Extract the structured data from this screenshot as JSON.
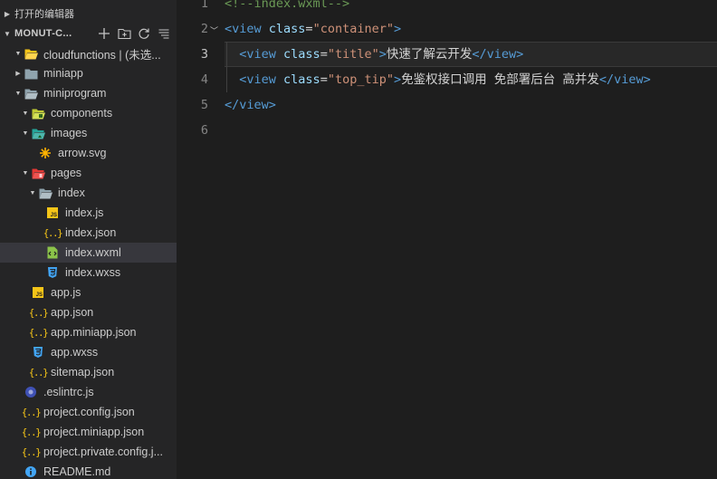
{
  "sidebar": {
    "open_editors_label": "打开的编辑器",
    "root_label": "MONUT-C...",
    "actions": [
      {
        "name": "new-file-icon"
      },
      {
        "name": "new-folder-icon"
      },
      {
        "name": "refresh-icon"
      },
      {
        "name": "collapse-all-icon"
      }
    ],
    "items": [
      {
        "depth": 0,
        "twisty": "open",
        "icon": "folder-cloud",
        "label": "cloudfunctions | (未选..."
      },
      {
        "depth": 0,
        "twisty": "closed",
        "icon": "folder",
        "label": "miniapp"
      },
      {
        "depth": 0,
        "twisty": "open",
        "icon": "folder-open",
        "label": "miniprogram"
      },
      {
        "depth": 1,
        "twisty": "open",
        "icon": "folder-components",
        "label": "components"
      },
      {
        "depth": 1,
        "twisty": "open",
        "icon": "folder-images",
        "label": "images"
      },
      {
        "depth": 2,
        "twisty": "none",
        "icon": "svg",
        "label": "arrow.svg"
      },
      {
        "depth": 1,
        "twisty": "open",
        "icon": "folder-pages",
        "label": "pages"
      },
      {
        "depth": 2,
        "twisty": "open",
        "icon": "folder-open",
        "label": "index"
      },
      {
        "depth": 3,
        "twisty": "none",
        "icon": "js",
        "label": "index.js"
      },
      {
        "depth": 3,
        "twisty": "none",
        "icon": "json",
        "label": "index.json"
      },
      {
        "depth": 3,
        "twisty": "none",
        "icon": "wxml",
        "label": "index.wxml",
        "selected": true
      },
      {
        "depth": 3,
        "twisty": "none",
        "icon": "css",
        "label": "index.wxss"
      },
      {
        "depth": 1,
        "twisty": "none",
        "icon": "js",
        "label": "app.js"
      },
      {
        "depth": 1,
        "twisty": "none",
        "icon": "json",
        "label": "app.json"
      },
      {
        "depth": 1,
        "twisty": "none",
        "icon": "json",
        "label": "app.miniapp.json"
      },
      {
        "depth": 1,
        "twisty": "none",
        "icon": "css",
        "label": "app.wxss"
      },
      {
        "depth": 1,
        "twisty": "none",
        "icon": "json",
        "label": "sitemap.json"
      },
      {
        "depth": 0,
        "twisty": "none",
        "icon": "eslint",
        "label": ".eslintrc.js"
      },
      {
        "depth": 0,
        "twisty": "none",
        "icon": "json",
        "label": "project.config.json"
      },
      {
        "depth": 0,
        "twisty": "none",
        "icon": "json",
        "label": "project.miniapp.json"
      },
      {
        "depth": 0,
        "twisty": "none",
        "icon": "json",
        "label": "project.private.config.j..."
      },
      {
        "depth": 0,
        "twisty": "none",
        "icon": "info",
        "label": "README.md"
      }
    ]
  },
  "editor": {
    "active_line": 3,
    "lines": [
      {
        "num": "1",
        "fold": false,
        "tokens": [
          {
            "t": "cm",
            "v": "<!--index.wxml-->"
          }
        ]
      },
      {
        "num": "2",
        "fold": true,
        "tokens": [
          {
            "t": "tag",
            "v": "<view"
          },
          {
            "t": "text",
            "v": " "
          },
          {
            "t": "attr",
            "v": "class"
          },
          {
            "t": "eq",
            "v": "="
          },
          {
            "t": "str",
            "v": "\"container\""
          },
          {
            "t": "tag",
            "v": ">"
          }
        ]
      },
      {
        "num": "3",
        "fold": false,
        "indent": true,
        "tokens": [
          {
            "t": "text",
            "v": "  "
          },
          {
            "t": "tag",
            "v": "<view"
          },
          {
            "t": "text",
            "v": " "
          },
          {
            "t": "attr",
            "v": "class"
          },
          {
            "t": "eq",
            "v": "="
          },
          {
            "t": "str",
            "v": "\"title\""
          },
          {
            "t": "tag",
            "v": ">"
          },
          {
            "t": "text",
            "v": "快速了解云开发"
          },
          {
            "t": "tag",
            "v": "</view>"
          }
        ]
      },
      {
        "num": "4",
        "fold": false,
        "indent": true,
        "tokens": [
          {
            "t": "text",
            "v": "  "
          },
          {
            "t": "tag",
            "v": "<view"
          },
          {
            "t": "text",
            "v": " "
          },
          {
            "t": "attr",
            "v": "class"
          },
          {
            "t": "eq",
            "v": "="
          },
          {
            "t": "str",
            "v": "\"top_tip\""
          },
          {
            "t": "tag",
            "v": ">"
          },
          {
            "t": "text",
            "v": "免鉴权接口调用 免部署后台 高并发"
          },
          {
            "t": "tag",
            "v": "</view>"
          }
        ]
      },
      {
        "num": "5",
        "fold": false,
        "tokens": [
          {
            "t": "tag",
            "v": "</view>"
          }
        ]
      },
      {
        "num": "6",
        "fold": false,
        "tokens": []
      }
    ]
  }
}
